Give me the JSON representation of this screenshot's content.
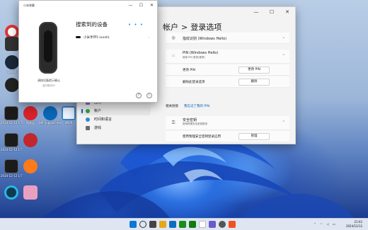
{
  "desktop_icons": [
    {
      "label": ""
    },
    {
      "label": ""
    },
    {
      "label": "Steam"
    },
    {
      "label": ""
    },
    {
      "label": "2024-12-12 1:59"
    },
    {
      "label": "2024-12-12 1:59"
    },
    {
      "label": "2024-12-12 1:59"
    },
    {
      "label": "网易云"
    },
    {
      "label": "HP Support Assistant"
    },
    {
      "label": "eNSP"
    },
    {
      "label": ""
    },
    {
      "label": ""
    },
    {
      "label": ""
    },
    {
      "label": ""
    },
    {
      "label": ""
    },
    {
      "label": ""
    }
  ],
  "mi_dialog": {
    "app_name": "小米穿戴",
    "heading": "搜索到的设备",
    "device_name": "小米手环5 (xxxh)",
    "hint": "请按设备提示确认",
    "hint_sub": "蓝牙配对中",
    "help": "?",
    "info": "i"
  },
  "settings": {
    "breadcrumb_parent": "帐户",
    "breadcrumb_sep": ">",
    "title": "登录选项",
    "rows": [
      {
        "title": "指纹识别 (Windows Hello)",
        "subtitle": ""
      },
      {
        "title": "PIN (Windows Hello)",
        "subtitle": "使用 PIN 登录(推荐)"
      }
    ],
    "change_pin_label": "更改 PIN",
    "change_pin_btn": "更改 PIN",
    "remove_label": "删除此登录选项",
    "remove_btn": "删除",
    "related": "相关链接",
    "forgot_pin": "我忘记了我的 PIN",
    "security_key_title": "安全密钥",
    "security_key_sub": "使用物理安全密钥登录",
    "manage_label": "使用物理安全密钥登录应用",
    "manage_btn": "管理",
    "nav": [
      {
        "label": "应用",
        "color": "#8a6ad8"
      },
      {
        "label": "帐户",
        "color": "#2ea043"
      },
      {
        "label": "时间和语言",
        "color": "#2b88d8"
      },
      {
        "label": "游戏",
        "color": "#6b6b6b"
      }
    ]
  },
  "taskbar": {
    "time": "21:02",
    "date": "2024/12/12"
  }
}
